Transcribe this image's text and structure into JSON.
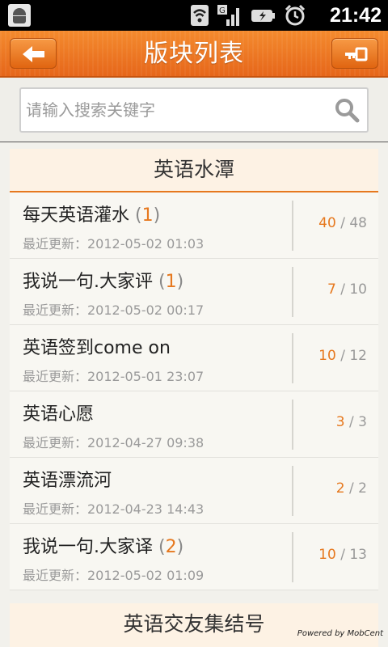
{
  "status_bar": {
    "time": "21:42",
    "icons": [
      "android-icon",
      "wifi-icon",
      "signal-icon",
      "battery-icon",
      "alarm-icon"
    ]
  },
  "title_bar": {
    "title": "版块列表",
    "back_icon": "arrow-left-icon",
    "right_icon": "key-icon"
  },
  "search": {
    "placeholder": "请输入搜索关键字",
    "value": ""
  },
  "sections": [
    {
      "title": "英语水潭",
      "boards": [
        {
          "name": "每天英语灌水",
          "new_count": "1",
          "updated": "最近更新：2012-05-02 01:03",
          "today": "40",
          "total": "48"
        },
        {
          "name": "我说一句.大家评",
          "new_count": "1",
          "updated": "最近更新：2012-05-02 00:17",
          "today": "7",
          "total": "10"
        },
        {
          "name": "英语签到come on",
          "new_count": "",
          "updated": "最近更新：2012-05-01 23:07",
          "today": "10",
          "total": "12"
        },
        {
          "name": "英语心愿",
          "new_count": "",
          "updated": "最近更新：2012-04-27 09:38",
          "today": "3",
          "total": "3"
        },
        {
          "name": "英语漂流河",
          "new_count": "",
          "updated": "最近更新：2012-04-23 14:43",
          "today": "2",
          "total": "2"
        },
        {
          "name": "我说一句.大家译",
          "new_count": "2",
          "updated": "最近更新：2012-05-02 01:09",
          "today": "10",
          "total": "13"
        }
      ]
    },
    {
      "title": "英语交友集结号",
      "boards": []
    }
  ],
  "footer": {
    "powered_by": "Powered by MobCent"
  },
  "colors": {
    "accent": "#e6781e",
    "title_bar": "#f07a22",
    "section_bg": "#fdf2e4"
  }
}
